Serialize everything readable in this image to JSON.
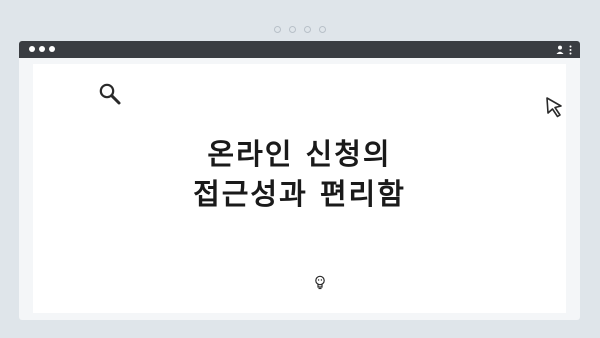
{
  "page": {
    "background_color": "#dfe5ea",
    "titlebar_color": "#3a3d42"
  },
  "icons": {
    "top_indicator": "four-small-circles",
    "window_controls": "three-white-dots",
    "menu": "user-icon-and-vertical-ellipsis",
    "search": "magnifying-glass-icon",
    "cursor": "mouse-pointer-icon",
    "bottom": "lightbulb-icon"
  },
  "headline": {
    "line1": "온라인 신청의",
    "line2": "접근성과 편리함"
  }
}
